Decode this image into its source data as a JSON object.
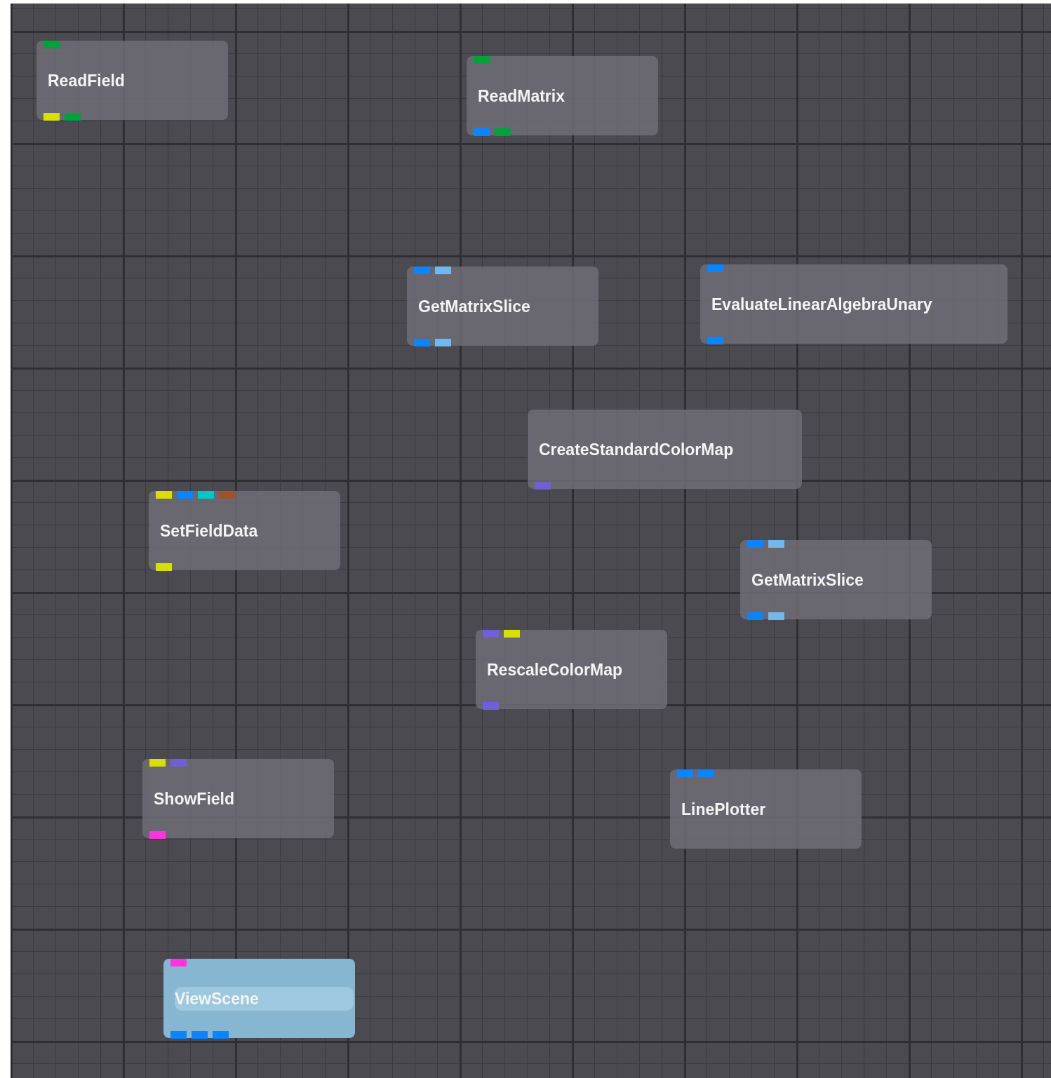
{
  "nodes": [
    {
      "name": "ReadField",
      "selected": false,
      "inputs": [
        {
          "color": "#00a23a"
        }
      ],
      "outputs": [
        {
          "color": "#d8e000"
        },
        {
          "color": "#00a23a"
        }
      ]
    },
    {
      "name": "ReadMatrix",
      "selected": false,
      "inputs": [
        {
          "color": "#00a23a"
        }
      ],
      "outputs": [
        {
          "color": "#0a84ff"
        },
        {
          "color": "#00a23a"
        }
      ]
    },
    {
      "name": "GetMatrixSlice",
      "selected": false,
      "inputs": [
        {
          "color": "#0a84ff"
        },
        {
          "color": "#6fb8f0"
        }
      ],
      "outputs": [
        {
          "color": "#0a84ff"
        },
        {
          "color": "#6fb8f0"
        }
      ]
    },
    {
      "name": "EvaluateLinearAlgebraUnary",
      "selected": false,
      "inputs": [
        {
          "color": "#0a84ff"
        }
      ],
      "outputs": [
        {
          "color": "#0a84ff"
        }
      ]
    },
    {
      "name": "CreateStandardColorMap",
      "selected": false,
      "outputs": [
        {
          "color": "#7060d8"
        }
      ]
    },
    {
      "name": "SetFieldData",
      "selected": false,
      "inputs": [
        {
          "color": "#d8e000"
        },
        {
          "color": "#0a84ff"
        },
        {
          "color": "#00c8c8"
        },
        {
          "color": "#a0522d"
        }
      ],
      "outputs": [
        {
          "color": "#d8e000"
        }
      ]
    },
    {
      "name": "GetMatrixSlice",
      "selected": false,
      "inputs": [
        {
          "color": "#0a84ff"
        },
        {
          "color": "#6fb8f0"
        }
      ],
      "outputs": [
        {
          "color": "#0a84ff"
        },
        {
          "color": "#6fb8f0"
        }
      ]
    },
    {
      "name": "RescaleColorMap",
      "selected": false,
      "inputs": [
        {
          "color": "#7060d8"
        },
        {
          "color": "#d8e000"
        }
      ],
      "outputs": [
        {
          "color": "#7060d8"
        }
      ]
    },
    {
      "name": "ShowField",
      "selected": false,
      "inputs": [
        {
          "color": "#d8e000"
        },
        {
          "color": "#7060d8"
        }
      ],
      "outputs": [
        {
          "color": "#ff33dd"
        }
      ]
    },
    {
      "name": "LinePlotter",
      "selected": false,
      "inputs": [
        {
          "color": "#0a84ff"
        },
        {
          "color": "#0a84ff"
        }
      ]
    },
    {
      "name": "ViewScene",
      "selected": true,
      "inputs": [
        {
          "color": "#ff33dd"
        }
      ],
      "outputs": [
        {
          "color": "#0a84ff"
        },
        {
          "color": "#0a84ff"
        },
        {
          "color": "#0a84ff"
        }
      ]
    }
  ]
}
